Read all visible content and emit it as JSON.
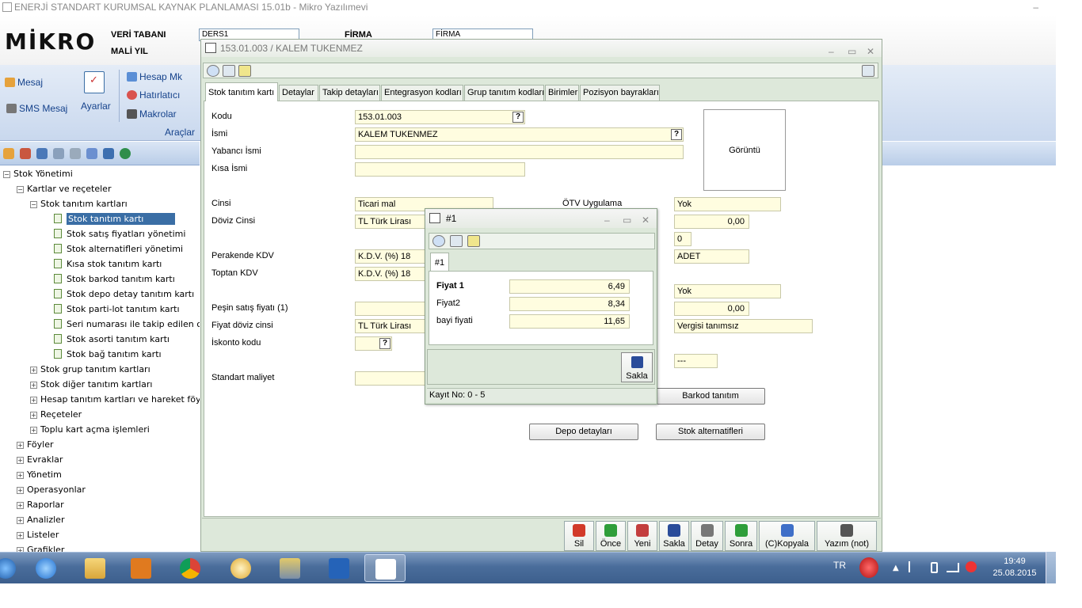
{
  "window_title": "ENERJİ STANDART KURUMSAL KAYNAK PLANLAMASI 15.01b -  Mikro Yazılımevi",
  "window_minimize": "–",
  "header": {
    "logo": "MİKRO",
    "veritabani_label": "VERİ TABANI",
    "maliyil_label": "MALİ YIL",
    "veritabani_value": "DERS1",
    "firma_label": "FİRMA",
    "firma_value": "FİRMA"
  },
  "ribbon": {
    "mesaj": "Mesaj",
    "sms_mesaj": "SMS Mesaj",
    "ayarlar": "Ayarlar",
    "hesap_mk": "Hesap Mk",
    "hatirlatici": "Hatırlatıcı",
    "makrolar": "Makrolar",
    "araclar": "Araçlar"
  },
  "tree": [
    {
      "label": "Stok Yönetimi",
      "level": 0,
      "toggle": "−",
      "type": "folder"
    },
    {
      "label": "Kartlar ve reçeteler",
      "level": 1,
      "toggle": "−",
      "type": "folder"
    },
    {
      "label": "Stok tanıtım kartları",
      "level": 2,
      "toggle": "−",
      "type": "folder"
    },
    {
      "label": "Stok tanıtım kartı",
      "level": 3,
      "type": "doc",
      "selected": true
    },
    {
      "label": "Stok satış fiyatları yönetimi",
      "level": 3,
      "type": "doc"
    },
    {
      "label": "Stok alternatifleri yönetimi",
      "level": 3,
      "type": "doc"
    },
    {
      "label": "Kısa stok tanıtım kartı",
      "level": 3,
      "type": "doc"
    },
    {
      "label": "Stok barkod tanıtım kartı",
      "level": 3,
      "type": "doc"
    },
    {
      "label": "Stok depo detay tanıtım kartı",
      "level": 3,
      "type": "doc"
    },
    {
      "label": "Stok parti-lot tanıtım kartı",
      "level": 3,
      "type": "doc"
    },
    {
      "label": "Seri numarası ile takip edilen cih",
      "level": 3,
      "type": "doc"
    },
    {
      "label": "Stok asorti tanıtım kartı",
      "level": 3,
      "type": "doc"
    },
    {
      "label": "Stok bağ tanıtım kartı",
      "level": 3,
      "type": "doc"
    },
    {
      "label": "Stok grup tanıtım kartları",
      "level": 2,
      "toggle": "+",
      "type": "folder"
    },
    {
      "label": "Stok diğer tanıtım kartları",
      "level": 2,
      "toggle": "+",
      "type": "folder"
    },
    {
      "label": "Hesap tanıtım kartları ve hareket föyleri",
      "level": 2,
      "toggle": "+",
      "type": "folder"
    },
    {
      "label": "Reçeteler",
      "level": 2,
      "toggle": "+",
      "type": "folder"
    },
    {
      "label": "Toplu kart açma işlemleri",
      "level": 2,
      "toggle": "+",
      "type": "folder"
    },
    {
      "label": "Föyler",
      "level": 1,
      "toggle": "+",
      "type": "folder"
    },
    {
      "label": "Evraklar",
      "level": 1,
      "toggle": "+",
      "type": "folder"
    },
    {
      "label": "Yönetim",
      "level": 1,
      "toggle": "+",
      "type": "folder"
    },
    {
      "label": "Operasyonlar",
      "level": 1,
      "toggle": "+",
      "type": "folder"
    },
    {
      "label": "Raporlar",
      "level": 1,
      "toggle": "+",
      "type": "folder"
    },
    {
      "label": "Analizler",
      "level": 1,
      "toggle": "+",
      "type": "folder"
    },
    {
      "label": "Listeler",
      "level": 1,
      "toggle": "+",
      "type": "folder"
    },
    {
      "label": "Grafikler",
      "level": 1,
      "toggle": "+",
      "type": "folder"
    }
  ],
  "main_window": {
    "title": "153.01.003 / KALEM TUKENMEZ",
    "minimize": "–",
    "maximize": "▭",
    "close": "✕",
    "tabs": [
      "Stok tanıtım kartı",
      "Detaylar",
      "Takip detayları",
      "Entegrasyon kodları",
      "Grup tanıtım kodları",
      "Birimler",
      "Pozisyon bayrakları"
    ],
    "labels": {
      "kodu": "Kodu",
      "ismi": "İsmi",
      "yabanci_ismi": "Yabancı İsmi",
      "kisa_ismi": "Kısa İsmi",
      "cinsi": "Cinsi",
      "doviz_cinsi": "Döviz Cinsi",
      "perakende_kdv": "Perakende KDV",
      "toptan_kdv": "Toptan KDV",
      "pesin_satis": "Peşin satış fiyatı (1)",
      "fiyat_doviz": "Fiyat döviz cinsi",
      "iskonto": "İskonto kodu",
      "standart_maliyet": "Standart maliyet",
      "otv": "ÖTV Uygulama"
    },
    "values": {
      "kodu": "153.01.003",
      "ismi": "KALEM TUKENMEZ",
      "yabanci_ismi": "",
      "kisa_ismi": "",
      "cinsi": "Ticari mal",
      "doviz_cinsi": "TL  Türk Lirası",
      "perakende_kdv": "K.D.V. (%) 18",
      "toptan_kdv": "K.D.V. (%) 18",
      "pesin_satis": "",
      "fiyat_doviz": "TL  Türk Lirası",
      "iskonto": "",
      "standart_maliyet": "",
      "otv": "Yok",
      "r_amount1": "0,00",
      "r_zero": "0",
      "r_adet": "ADET",
      "r_yok2": "Yok",
      "r_amount2": "0,00",
      "r_vergi": "Vergisi tanımsız",
      "r_dash": "---"
    },
    "question": "?",
    "goruntu": "Görüntü",
    "buttons": {
      "barkod": "Barkod tanıtım",
      "depo": "Depo detayları",
      "alternatif": "Stok alternatifleri"
    },
    "bottom_buttons": [
      "Sil",
      "Önce",
      "Yeni",
      "Sakla",
      "Detay",
      "Sonra",
      "(C)Kopyala",
      "Yazım (not)"
    ],
    "bottom_colors": [
      "#d23a2a",
      "#2f9e3a",
      "#c33e3e",
      "#2a4c9a",
      "#777777",
      "#2f9e3a",
      "#3f6fc8",
      "#555555"
    ]
  },
  "popup": {
    "title": "#1",
    "minimize": "–",
    "maximize": "▭",
    "close": "✕",
    "tab": "#1",
    "rows": [
      {
        "label": "Fiyat 1",
        "value": "6,49",
        "bold": true
      },
      {
        "label": "Fiyat2",
        "value": "8,34",
        "bold": false
      },
      {
        "label": "bayi fiyati",
        "value": "11,65",
        "bold": false
      }
    ],
    "save_label": "Sakla",
    "status": "Kayıt No: 0 - 5"
  },
  "taskbar": {
    "lang": "TR",
    "time": "19:49",
    "date": "25.08.2015"
  }
}
